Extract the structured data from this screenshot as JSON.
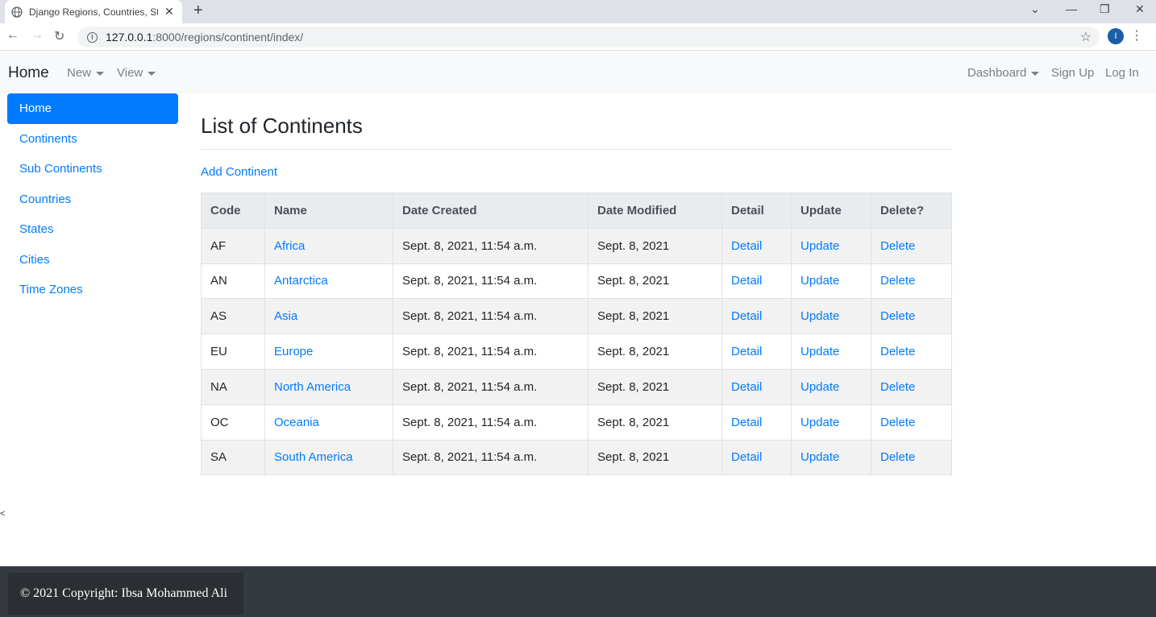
{
  "browser": {
    "tab_title": "Django Regions, Countries, States",
    "url_host": "127.0.0.1",
    "url_path": ":8000/regions/continent/index/",
    "profile_initial": "I"
  },
  "navbar": {
    "brand": "Home",
    "new_label": "New",
    "view_label": "View",
    "dashboard_label": "Dashboard",
    "signup_label": "Sign Up",
    "login_label": "Log In"
  },
  "sidebar": {
    "items": [
      {
        "label": "Home",
        "active": true
      },
      {
        "label": "Continents"
      },
      {
        "label": "Sub Continents"
      },
      {
        "label": "Countries"
      },
      {
        "label": "States"
      },
      {
        "label": "Cities"
      },
      {
        "label": "Time Zones"
      }
    ]
  },
  "main": {
    "title": "List of Continents",
    "add_label": "Add Continent",
    "columns": [
      "Code",
      "Name",
      "Date Created",
      "Date Modified",
      "Detail",
      "Update",
      "Delete?"
    ],
    "rows": [
      {
        "code": "AF",
        "name": "Africa",
        "created": "Sept. 8, 2021, 11:54 a.m.",
        "modified": "Sept. 8, 2021",
        "detail": "Detail",
        "update": "Update",
        "delete": "Delete"
      },
      {
        "code": "AN",
        "name": "Antarctica",
        "created": "Sept. 8, 2021, 11:54 a.m.",
        "modified": "Sept. 8, 2021",
        "detail": "Detail",
        "update": "Update",
        "delete": "Delete"
      },
      {
        "code": "AS",
        "name": "Asia",
        "created": "Sept. 8, 2021, 11:54 a.m.",
        "modified": "Sept. 8, 2021",
        "detail": "Detail",
        "update": "Update",
        "delete": "Delete"
      },
      {
        "code": "EU",
        "name": "Europe",
        "created": "Sept. 8, 2021, 11:54 a.m.",
        "modified": "Sept. 8, 2021",
        "detail": "Detail",
        "update": "Update",
        "delete": "Delete"
      },
      {
        "code": "NA",
        "name": "North America",
        "created": "Sept. 8, 2021, 11:54 a.m.",
        "modified": "Sept. 8, 2021",
        "detail": "Detail",
        "update": "Update",
        "delete": "Delete"
      },
      {
        "code": "OC",
        "name": "Oceania",
        "created": "Sept. 8, 2021, 11:54 a.m.",
        "modified": "Sept. 8, 2021",
        "detail": "Detail",
        "update": "Update",
        "delete": "Delete"
      },
      {
        "code": "SA",
        "name": "South America",
        "created": "Sept. 8, 2021, 11:54 a.m.",
        "modified": "Sept. 8, 2021",
        "detail": "Detail",
        "update": "Update",
        "delete": "Delete"
      }
    ]
  },
  "stray_text": "<",
  "footer": {
    "text": "© 2021 Copyright: Ibsa Mohammed Ali"
  },
  "colors": {
    "primary": "#007bff",
    "footer_bg": "#343a40",
    "navbar_bg": "#f8f9fa"
  }
}
